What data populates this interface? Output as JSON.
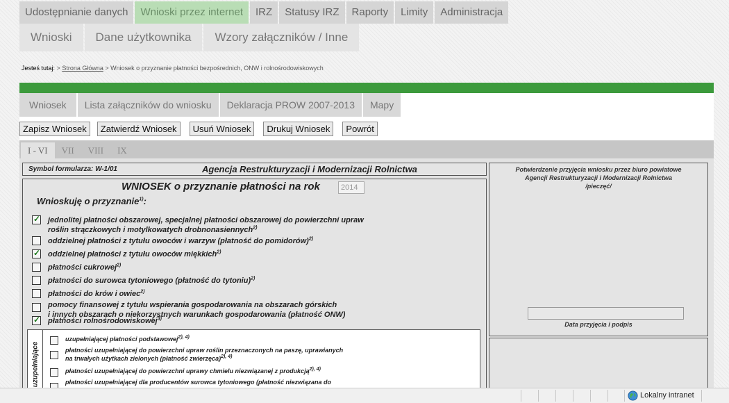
{
  "top_nav": {
    "items": [
      "Udostępnianie danych",
      "Wnioski przez internet",
      "IRZ",
      "Statusy IRZ",
      "Raporty",
      "Limity",
      "Administracja"
    ],
    "active": "Wnioski przez internet",
    "active_color": "#b9ddb5"
  },
  "sub_nav": {
    "items": [
      "Wnioski",
      "Dane użytkownika",
      "Wzory załączników / Inne"
    ]
  },
  "breadcrumb": {
    "label": "Jesteś tutaj:",
    "separator": ">",
    "home_link": "Strona Główna",
    "current": "Wniosek o przyznanie płatności bezpośrednich, ONW i rolnośrodowiskowych"
  },
  "accent_color": "#3c9a3c",
  "doc_tabs": [
    "Wniosek",
    "Lista załączników do wniosku",
    "Deklaracja PROW 2007-2013",
    "Mapy"
  ],
  "actions": {
    "save": "Zapisz Wniosek",
    "approve": "Zatwierdź Wniosek",
    "delete": "Usuń Wniosek",
    "print": "Drukuj Wniosek",
    "back": "Powrót"
  },
  "page_tabs": [
    "I - VI",
    "VII",
    "VIII",
    "IX"
  ],
  "active_page_tab": "I - VI",
  "form": {
    "symbol": "Symbol formularza: W-1/01",
    "agency": "Agencja Restrukturyzacji i Modernizacji Rolnictwa",
    "title": "WNIOSEK o przyznanie płatności na rok",
    "year_value": "2014",
    "request_label": "Wnioskuję o przyznanie",
    "request_sup": "1)",
    "options": [
      {
        "line1": "jednolitej płatności obszarowej, specjalnej płatności obszarowej do powierzchni upraw",
        "line2": "roślin strączkowych i motylkowatych drobnonasiennych",
        "sup": "2)",
        "checked": true
      },
      {
        "line1": "oddzielnej płatności z tytułu owoców i warzyw (płatność do pomidorów)",
        "line2": "",
        "sup": "2)",
        "checked": false
      },
      {
        "line1": "oddzielnej płatności z tytułu owoców miękkich",
        "line2": "",
        "sup": "2)",
        "checked": true
      },
      {
        "line1": "płatności cukrowej",
        "line2": "",
        "sup": "2)",
        "checked": false
      },
      {
        "line1": "płatności do surowca tytoniowego (płatność do tytoniu)",
        "line2": "",
        "sup": "2)",
        "checked": false
      },
      {
        "line1": "płatności do krów i owiec",
        "line2": "",
        "sup": "2)",
        "checked": false
      },
      {
        "line1": "pomocy finansowej z tytułu wspierania gospodarowania na obszarach górskich",
        "line2": "i innych obszarach o niekorzystnych warunkach gospodarowania (płatność ONW)",
        "sup": "",
        "checked": false
      },
      {
        "line1": "płatności rolnośrodowiskowej",
        "line2": "",
        "sup": "3)",
        "checked": true
      }
    ],
    "supplementary_label": "ci uzupełniające",
    "supplementary": [
      {
        "line1": "uzupełniającej płatności podstawowej",
        "line2": "",
        "sup": "2), 4)"
      },
      {
        "line1": "płatności uzupełniającej do powierzchni upraw roślin przeznaczonych na paszę, uprawianych",
        "line2": "na trwałych użytkach zielonych (płatność zwierzęca)",
        "sup": "2), 4)"
      },
      {
        "line1": "płatności uzupełniającej do powierzchni uprawy chmielu niezwiązanej z produkcją",
        "line2": "",
        "sup": "2), 4)"
      },
      {
        "line1": "płatności uzupełniającej dla producentów surowca tytoniowego (płatność niezwiązana do",
        "line2": "",
        "sup": ""
      }
    ],
    "confirmation_line1": "Potwierdzenie przyjęcia wniosku przez biuro powiatowe",
    "confirmation_line2": "Agencji Restrukturyzacji i Modernizacji Rolnictwa",
    "confirmation_line3": "/pieczęć/",
    "date_label": "Data przyjęcia i podpis"
  },
  "status_bar": {
    "zone": "Lokalny intranet",
    "zone_icon": "globe-icon"
  }
}
